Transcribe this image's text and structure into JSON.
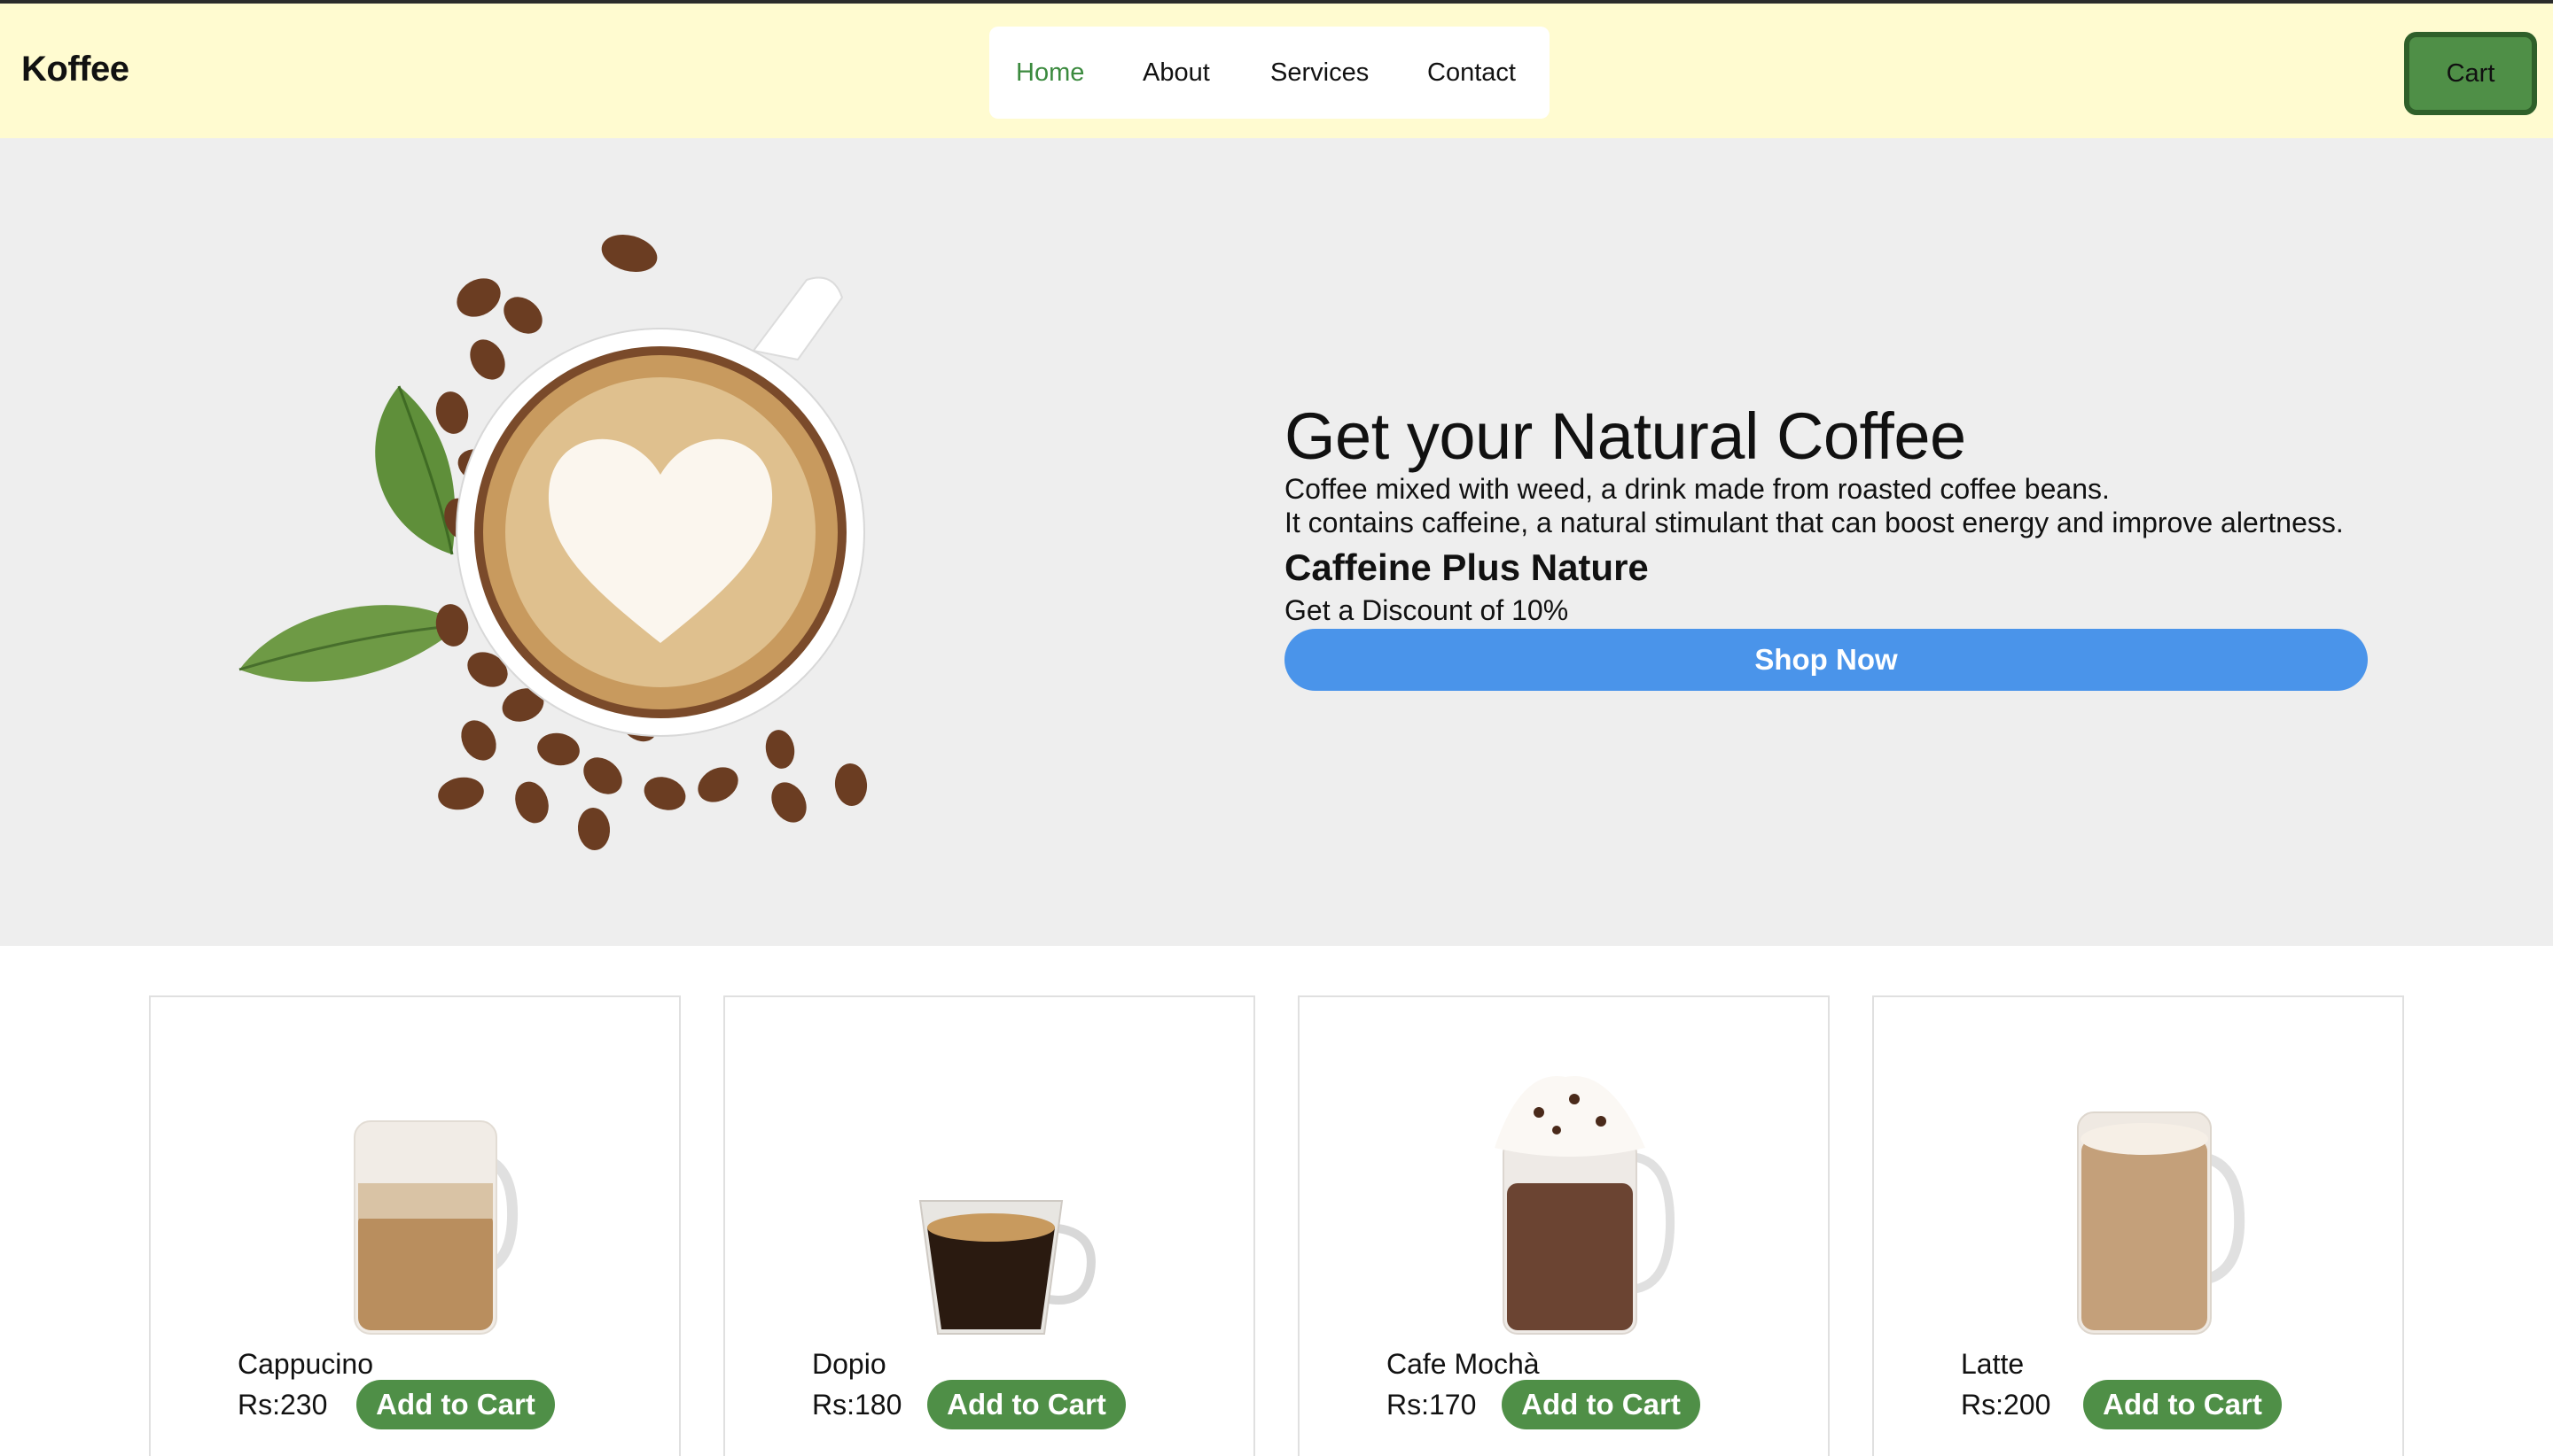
{
  "header": {
    "logo": "Koffee",
    "nav": [
      "Home",
      "About",
      "Services",
      "Contact"
    ],
    "active_nav": "Home",
    "cart_label": "Cart"
  },
  "hero": {
    "title": "Get your Natural Coffee",
    "desc_line1": "Coffee mixed with weed, a drink made from roasted coffee beans.",
    "desc_line2": "It contains caffeine, a natural stimulant that can boost energy and improve alertness.",
    "subtitle": "Caffeine Plus Nature",
    "discount": "Get a Discount of 10%",
    "cta": "Shop Now"
  },
  "products": [
    {
      "name": "Cappucino",
      "price": "Rs:230",
      "button": "Add to Cart"
    },
    {
      "name": "Dopio",
      "price": "Rs:180",
      "button": "Add to Cart"
    },
    {
      "name": "Cafe Mochà",
      "price": "Rs:170",
      "button": "Add to Cart"
    },
    {
      "name": "Latte",
      "price": "Rs:200",
      "button": "Add to Cart"
    }
  ],
  "colors": {
    "header_bg": "#fffbd0",
    "hero_bg": "#eeeeee",
    "accent_green": "#4f8f47",
    "active_nav": "#3b8a3e",
    "cta_blue": "#4a94ea"
  }
}
